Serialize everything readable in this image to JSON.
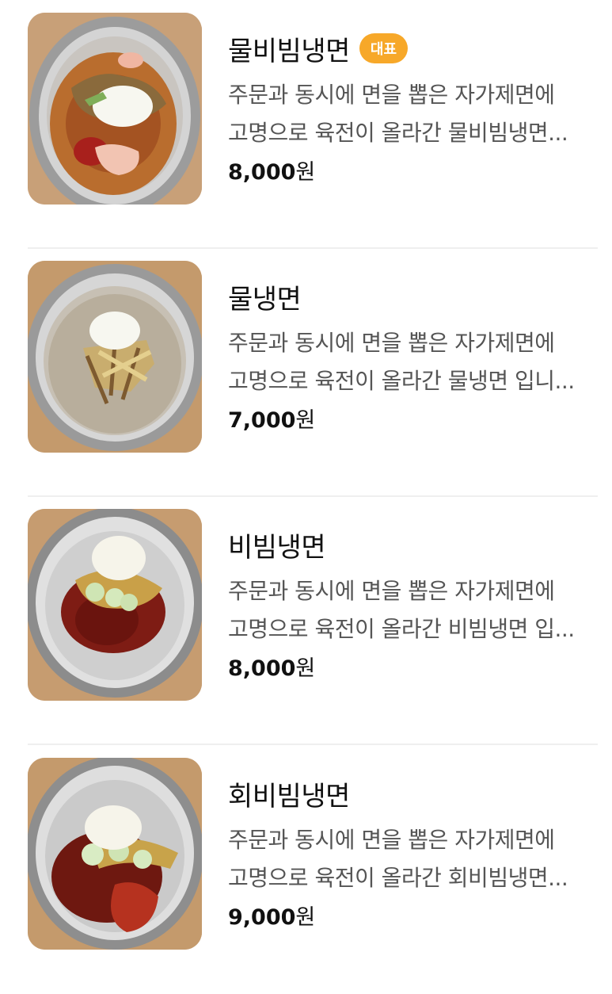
{
  "menu": {
    "items": [
      {
        "name": "물비빔냉면",
        "badge": "대표",
        "desc_line1": "주문과 동시에 면을 뽑은 자가제면에",
        "desc_line2": "고명으로 육전이 올라간 물비빔냉면...",
        "price_number": "8,000",
        "price_unit": "원"
      },
      {
        "name": "물냉면",
        "desc_line1": "주문과 동시에 면을 뽑은 자가제면에",
        "desc_line2": "고명으로 육전이 올라간 물냉면 입니...",
        "price_number": "7,000",
        "price_unit": "원"
      },
      {
        "name": "비빔냉면",
        "desc_line1": "주문과 동시에 면을 뽑은 자가제면에",
        "desc_line2": "고명으로 육전이 올라간 비빔냉면 입...",
        "price_number": "8,000",
        "price_unit": "원"
      },
      {
        "name": "회비빔냉면",
        "desc_line1": "주문과 동시에 면을 뽑은 자가제면에",
        "desc_line2": "고명으로 육전이 올라간 회비빔냉면...",
        "price_number": "9,000",
        "price_unit": "원"
      }
    ]
  },
  "colors": {
    "badge": "#f7a829",
    "divider": "#efefef",
    "desc_text": "#555555"
  }
}
